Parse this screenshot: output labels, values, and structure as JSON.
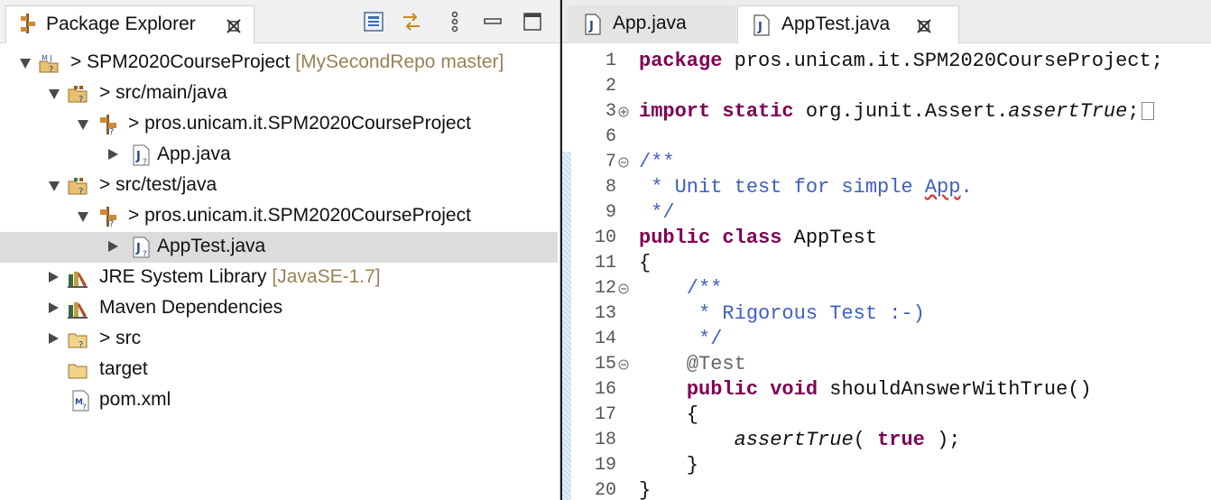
{
  "explorer": {
    "title": "Package Explorer",
    "tree": [
      {
        "label": "SPM2020CourseProject",
        "deco": "[MySecondRepo master]",
        "prefix": "> "
      },
      {
        "label": "src/main/java",
        "prefix": "> "
      },
      {
        "label": "pros.unicam.it.SPM2020CourseProject",
        "prefix": "> "
      },
      {
        "label": "App.java"
      },
      {
        "label": "src/test/java",
        "prefix": "> "
      },
      {
        "label": "pros.unicam.it.SPM2020CourseProject",
        "prefix": "> "
      },
      {
        "label": "AppTest.java"
      },
      {
        "label": "JRE System Library",
        "deco": "[JavaSE-1.7]"
      },
      {
        "label": "Maven Dependencies"
      },
      {
        "label": "src",
        "prefix": "> "
      },
      {
        "label": "target"
      },
      {
        "label": "pom.xml"
      }
    ]
  },
  "editor": {
    "tabs": [
      {
        "label": "App.java",
        "active": false
      },
      {
        "label": "AppTest.java",
        "active": true
      }
    ],
    "line_numbers": [
      "1",
      "2",
      "3",
      "6",
      "7",
      "8",
      "9",
      "10",
      "11",
      "12",
      "13",
      "14",
      "15",
      "16",
      "17",
      "18",
      "19",
      "20"
    ],
    "code": {
      "l1_kw": "package",
      "l1_rest": " pros.unicam.it.SPM2020CourseProject;",
      "l3_kw1": "import",
      "l3_kw2": "static",
      "l3_rest": " org.junit.Assert.",
      "l3_it": "assertTrue",
      "l3_end": ";",
      "l7": "/**",
      "l8_pre": " * Unit test for simple ",
      "l8_sq": "App",
      "l8_end": ".",
      "l9": " */",
      "l10_kw1": "public",
      "l10_kw2": "class",
      "l10_rest": " AppTest",
      "l11": "{",
      "l12": "    /**",
      "l13": "     * Rigorous Test :-)",
      "l14": "     */",
      "l15": "    @Test",
      "l16_pre": "    ",
      "l16_kw1": "public",
      "l16_kw2": "void",
      "l16_rest": " shouldAnswerWithTrue()",
      "l17": "    {",
      "l18_pre": "        ",
      "l18_it": "assertTrue",
      "l18_mid": "( ",
      "l18_kw": "true",
      "l18_end": " );",
      "l19": "    }",
      "l20": "}"
    }
  },
  "colors": {
    "keyword": "#7f0055",
    "comment": "#3f5fbf",
    "annotation": "#646464",
    "decoration": "#9a8155",
    "selection": "#dcdcdc"
  }
}
